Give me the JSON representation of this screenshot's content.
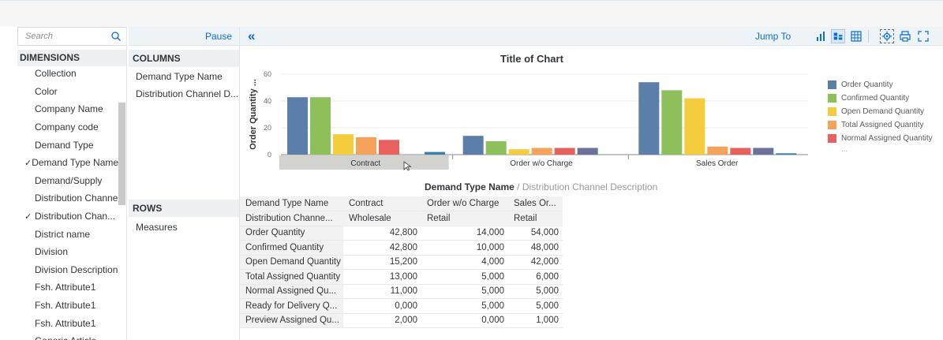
{
  "search": {
    "placeholder": "Search"
  },
  "dimensions": {
    "header": "DIMENSIONS",
    "items": [
      {
        "label": "Collection",
        "checked": false
      },
      {
        "label": "Color",
        "checked": false
      },
      {
        "label": "Company Name",
        "checked": false
      },
      {
        "label": "Company code",
        "checked": false
      },
      {
        "label": "Demand Type",
        "checked": false
      },
      {
        "label": "Demand Type Name",
        "checked": true
      },
      {
        "label": "Demand/Supply",
        "checked": false
      },
      {
        "label": "Distribution Channel",
        "checked": false
      },
      {
        "label": "Distribution Chan...",
        "checked": true
      },
      {
        "label": "District name",
        "checked": false
      },
      {
        "label": "Division",
        "checked": false
      },
      {
        "label": "Division Description",
        "checked": false
      },
      {
        "label": "Fsh. Attribute1",
        "checked": false
      },
      {
        "label": "Fsh. Attribute1",
        "checked": false
      },
      {
        "label": "Fsh. Attribute1",
        "checked": false
      },
      {
        "label": "Generic Article",
        "checked": false
      }
    ],
    "check_mark": "✓"
  },
  "pause_label": "Pause",
  "columns": {
    "header": "COLUMNS",
    "items": [
      "Demand Type Name",
      "Distribution Channel D..."
    ]
  },
  "rows": {
    "header": "ROWS",
    "items": [
      "Measures"
    ]
  },
  "toolbar": {
    "collapse_glyph": "«",
    "jump_to": "Jump To",
    "icons": [
      "bar-chart-icon",
      "stacked-chart-icon",
      "table-view-icon",
      "settings-icon",
      "print-icon",
      "fullscreen-icon"
    ]
  },
  "chart_data": {
    "type": "bar",
    "title": "Title of Chart",
    "ylabel": "Order Quantity ...",
    "xlabel_main": "Demand Type Name",
    "xlabel_sep": " / ",
    "xlabel_sub": "Distribution Channel Description",
    "ylim": [
      0,
      60
    ],
    "yticks": [
      0,
      20,
      40,
      60
    ],
    "categories": [
      "Contract",
      "Order w/o Charge",
      "Sales Order"
    ],
    "series": [
      {
        "name": "Order Quantity",
        "color": "#5b7fa8",
        "values": [
          42800,
          14000,
          54000
        ]
      },
      {
        "name": "Confirmed Quantity",
        "color": "#8dbf5a",
        "values": [
          42800,
          10000,
          48000
        ]
      },
      {
        "name": "Open Demand Quantity",
        "color": "#f4cc3e",
        "values": [
          15200,
          4000,
          42000
        ]
      },
      {
        "name": "Total Assigned Quantity",
        "color": "#f5a35a",
        "values": [
          13000,
          5000,
          6000
        ]
      },
      {
        "name": "Normal Assigned Quantity",
        "color": "#e8615f",
        "values": [
          11000,
          5000,
          5000
        ]
      },
      {
        "name": "Ready for Delivery Quantity",
        "color": "#6b7398",
        "values": [
          0,
          5000,
          5000
        ]
      },
      {
        "name": "Preview Assigned Quantity",
        "color": "#3d7fa8",
        "values": [
          2000,
          0,
          1000
        ]
      }
    ],
    "legend_visible": [
      "Order Quantity",
      "Confirmed Quantity",
      "Open Demand Quantity",
      "Total Assigned Quantity",
      "Normal Assigned Quantity"
    ],
    "legend_more": "...",
    "legend_position": "right",
    "grid": true
  },
  "table": {
    "header_row1": [
      "Demand Type Name",
      "Contract",
      "Order w/o Charge",
      "Sales Or..."
    ],
    "header_row2": [
      "Distribution Channe...",
      "Wholesale",
      "Retail",
      "Retail"
    ],
    "rows": [
      {
        "measure": "Order Quantity",
        "values": [
          "42,800",
          "14,000",
          "54,000"
        ]
      },
      {
        "measure": "Confirmed Quantity",
        "values": [
          "42,800",
          "10,000",
          "48,000"
        ]
      },
      {
        "measure": "Open Demand Quantity",
        "values": [
          "15,200",
          "4,000",
          "42,000"
        ]
      },
      {
        "measure": "Total Assigned Quantity",
        "values": [
          "13,000",
          "5,000",
          "6,000"
        ]
      },
      {
        "measure": "Normal Assigned Qu...",
        "values": [
          "11,000",
          "5,000",
          "5,000"
        ]
      },
      {
        "measure": "Ready for Delivery Q...",
        "values": [
          "0,000",
          "5,000",
          "5,000"
        ]
      },
      {
        "measure": "Preview Assigned Qu...",
        "values": [
          "2,000",
          "0,000",
          "1,000"
        ]
      }
    ]
  }
}
